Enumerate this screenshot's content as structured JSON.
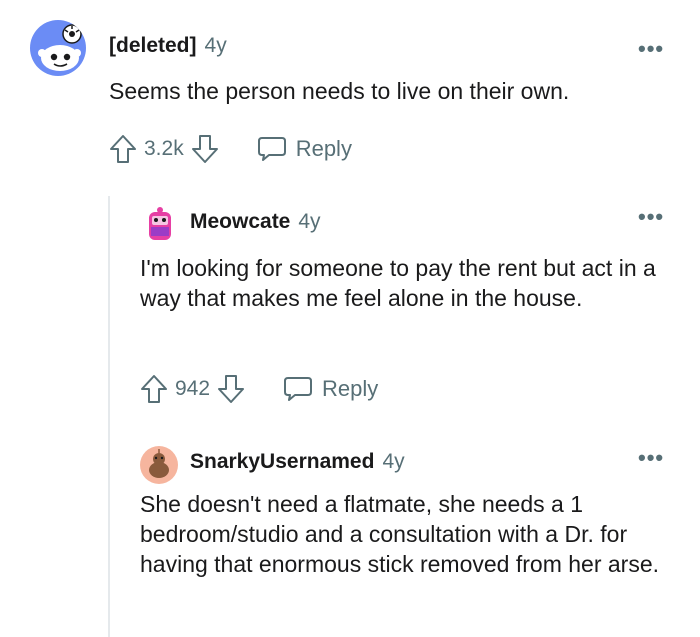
{
  "comments": [
    {
      "author": "[deleted]",
      "age": "4y",
      "text": "Seems the person needs to live on their own.",
      "score": "3.2k",
      "reply_label": "Reply",
      "more_label": "•••",
      "avatar_icon": "snoo-deleted-avatar"
    },
    {
      "author": "Meowcate",
      "age": "4y",
      "text": "I'm looking for someone to pay the rent but act in a way that makes me feel alone in the house.",
      "score": "942",
      "reply_label": "Reply",
      "more_label": "•••",
      "avatar_icon": "pink-snoo-avatar"
    },
    {
      "author": "SnarkyUsernamed",
      "age": "4y",
      "text": "She doesn't need a flatmate, she needs a 1 bedroom/studio and a consultation with a Dr. for having that enormous stick removed from her arse.",
      "more_label": "•••",
      "avatar_icon": "orange-snoo-avatar"
    }
  ],
  "colors": {
    "meta_gray": "#576f76",
    "text": "#1a1a1b",
    "thread_line": "#e5e9ec",
    "deleted_avatar_bg": "#6b8cf5",
    "snarky_avatar_bg": "#f6b59e"
  }
}
